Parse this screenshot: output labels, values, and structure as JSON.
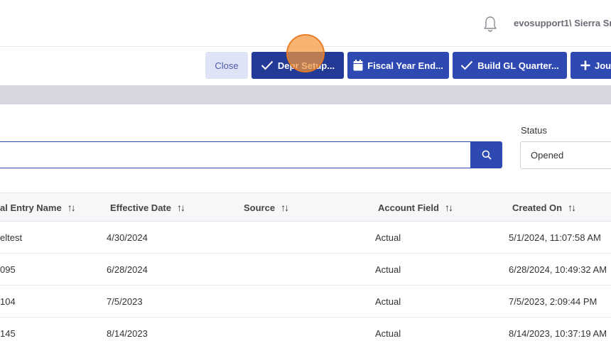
{
  "header": {
    "username": "evosupport1\\ Sierra Sm",
    "notification_icon": "bell-icon"
  },
  "toolbar": {
    "close_label": "Close",
    "depr_setup_label": "Depr Setup...",
    "fiscal_year_label": "Fiscal Year End...",
    "build_gl_label": "Build GL Quarter...",
    "journal_label": "Jour"
  },
  "filters": {
    "search_value": "",
    "status_label": "Status",
    "status_value": "Opened"
  },
  "table": {
    "columns": [
      "al Entry Name",
      "Effective Date",
      "Source",
      "Account Field",
      "Created On"
    ],
    "rows": [
      [
        "eltest",
        "4/30/2024",
        "",
        "Actual",
        "5/1/2024, 11:07:58 AM"
      ],
      [
        "095",
        "6/28/2024",
        "",
        "Actual",
        "6/28/2024, 10:49:32 AM"
      ],
      [
        "104",
        "7/5/2023",
        "",
        "Actual",
        "7/5/2023, 2:09:44 PM"
      ],
      [
        "145",
        "8/14/2023",
        "",
        "Actual",
        "8/14/2023, 10:37:19 AM"
      ]
    ]
  },
  "colors": {
    "primary": "#2f49b3",
    "primary_dark": "#233a96",
    "close_bg": "#dfe3f6",
    "band": "#d7d8df",
    "click_marker": "#f5963c"
  }
}
